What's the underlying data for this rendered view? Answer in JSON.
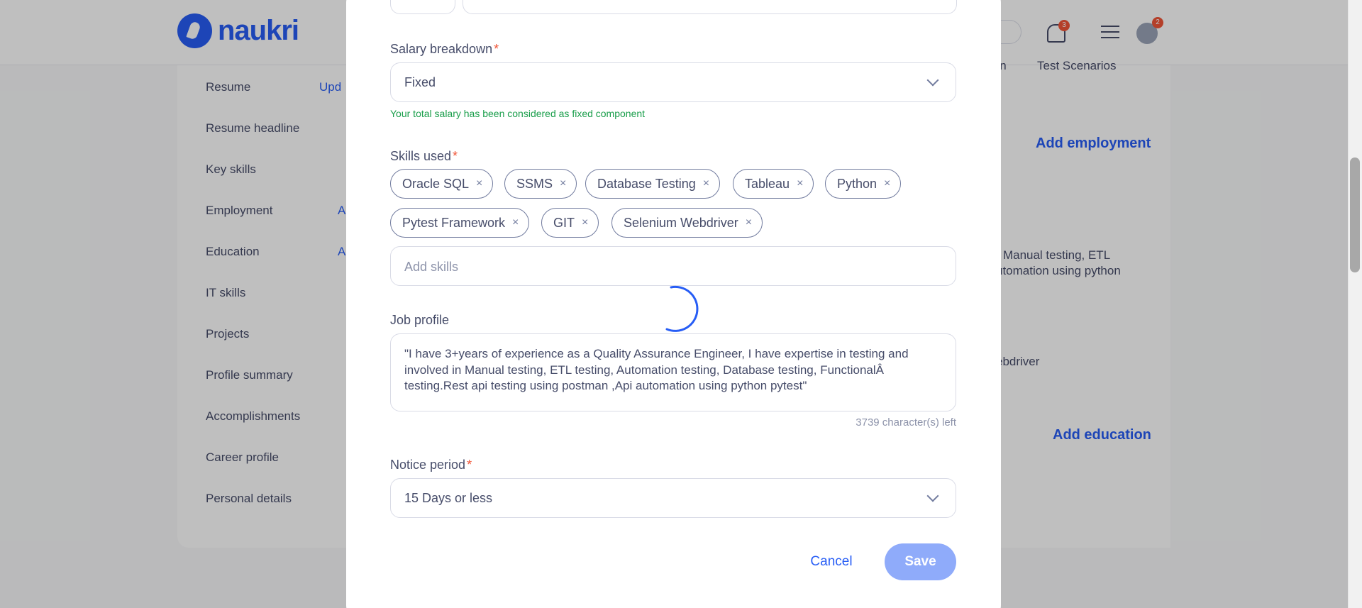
{
  "background": {
    "brand": "naukri",
    "notification_count": "3",
    "avatar_badge": "2",
    "sidebar_items": [
      "Resume",
      "Resume headline",
      "Key skills",
      "Employment",
      "Education",
      "IT skills",
      "Projects",
      "Profile summary",
      "Accomplishments",
      "Career profile",
      "Personal details"
    ],
    "sidebar_links": [
      "Upd",
      "A",
      "A"
    ],
    "tabs": [
      "ion",
      "Test Scenarios"
    ],
    "add_employment": "Add employment",
    "add_education": "Add education",
    "snippet_1": "in Manual testing, ETL",
    "snippet_2": "utomation using python",
    "snippet_3": "ebdriver"
  },
  "modal": {
    "salary_breakdown": {
      "label": "Salary breakdown",
      "value": "Fixed",
      "hint": "Your total salary has been considered as fixed component"
    },
    "skills": {
      "label": "Skills used",
      "chips": [
        "Oracle SQL",
        "SSMS",
        "Database Testing",
        "Tableau",
        "Python",
        "Pytest Framework",
        "GIT",
        "Selenium Webdriver"
      ],
      "remove_glyph": "×",
      "placeholder": "Add skills"
    },
    "job_profile": {
      "label": "Job profile",
      "value": "\"I have 3+years of experience as a Quality Assurance Engineer, I have expertise in testing and involved in Manual testing, ETL testing, Automation testing, Database testing, FunctionalÂ testing.Rest api testing using postman ,Api automation using python pytest\"",
      "chars_left": "3739 character(s) left"
    },
    "notice_period": {
      "label": "Notice period",
      "value": "15 Days or less"
    },
    "required_mark": "*",
    "cancel_label": "Cancel",
    "save_label": "Save"
  },
  "colors": {
    "accent": "#275df5",
    "required": "#f05537",
    "hint_green": "#1a9e4b",
    "save_disabled": "#8fabfa",
    "spinner": "#275df5"
  }
}
